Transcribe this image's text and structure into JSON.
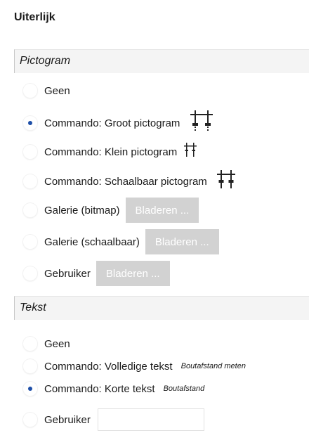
{
  "title": "Uiterlijk",
  "pictogram": {
    "header": "Pictogram",
    "options": [
      {
        "label": "Geen",
        "selected": false
      },
      {
        "label": "Commando: Groot pictogram",
        "selected": true,
        "icon": "crossbar-large-icon"
      },
      {
        "label": "Commando: Klein pictogram",
        "selected": false,
        "icon": "crossbar-small-icon"
      },
      {
        "label": "Commando: Schaalbaar pictogram",
        "selected": false,
        "icon": "crossbar-scalable-icon"
      },
      {
        "label": "Galerie (bitmap)",
        "selected": false,
        "button": "Bladeren ..."
      },
      {
        "label": "Galerie (schaalbaar)",
        "selected": false,
        "button": "Bladeren ..."
      },
      {
        "label": "Gebruiker",
        "selected": false,
        "button": "Bladeren ..."
      }
    ]
  },
  "tekst": {
    "header": "Tekst",
    "options": [
      {
        "label": "Geen",
        "selected": false
      },
      {
        "label": "Commando: Volledige tekst",
        "selected": false,
        "note": "Boutafstand meten"
      },
      {
        "label": "Commando: Korte tekst",
        "selected": true,
        "note": "Boutafstand"
      },
      {
        "label": "Gebruiker",
        "selected": false,
        "input_value": ""
      }
    ]
  },
  "colors": {
    "selected_dot": "#1e4fa8",
    "disabled_button_bg": "#d2d2d2",
    "header_bg": "#f4f4f4"
  }
}
